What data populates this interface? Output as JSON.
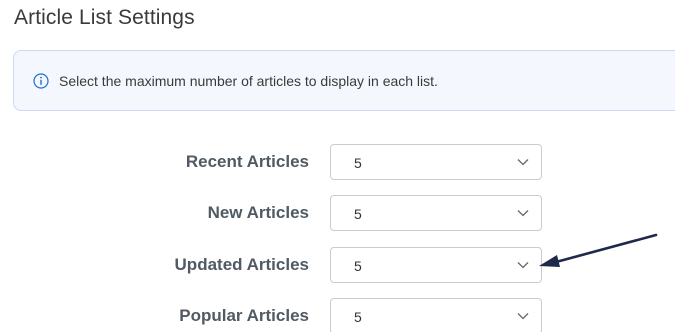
{
  "page": {
    "title": "Article List Settings"
  },
  "info": {
    "icon": "info-circle-icon",
    "message": "Select the maximum number of articles to display in each list."
  },
  "fields": [
    {
      "label": "Recent Articles",
      "value": "5"
    },
    {
      "label": "New Articles",
      "value": "5"
    },
    {
      "label": "Updated Articles",
      "value": "5"
    },
    {
      "label": "Popular Articles",
      "value": "5"
    }
  ],
  "colors": {
    "accent": "#1f6ed4",
    "info_background": "#f4f8fe",
    "info_border": "#c9daf2",
    "label": "#505a63",
    "annotation_arrow": "#1e2a4a"
  }
}
